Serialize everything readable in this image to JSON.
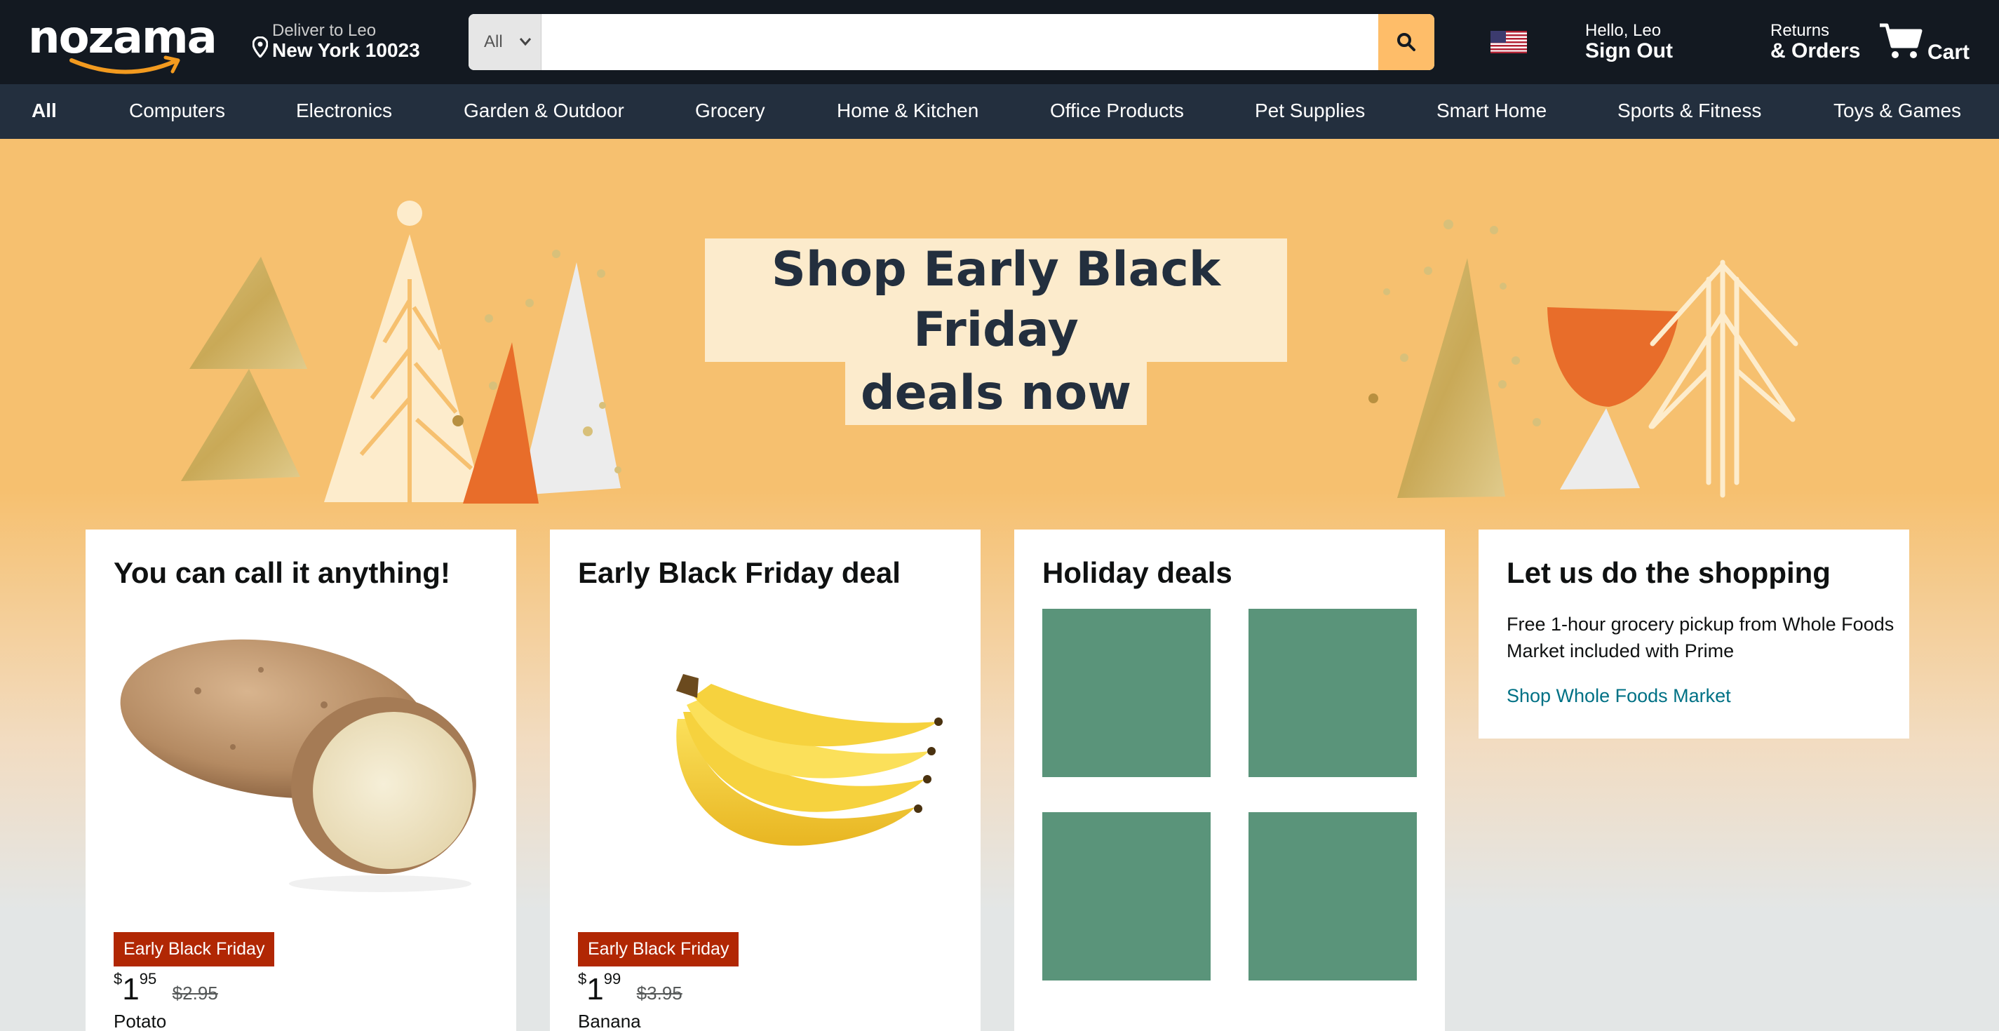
{
  "header": {
    "logo_text": "nozama",
    "deliver_line1": "Deliver to Leo",
    "deliver_line2": "New York 10023",
    "search": {
      "category": "All",
      "value": "",
      "placeholder": ""
    },
    "account_line1": "Hello, Leo",
    "account_line2": "Sign Out",
    "returns_line1": "Returns",
    "returns_line2": "& Orders",
    "cart_label": "Cart"
  },
  "nav": {
    "items": [
      {
        "label": "All"
      },
      {
        "label": "Computers"
      },
      {
        "label": "Electronics"
      },
      {
        "label": "Garden & Outdoor"
      },
      {
        "label": "Grocery"
      },
      {
        "label": "Home & Kitchen"
      },
      {
        "label": "Office Products"
      },
      {
        "label": "Pet Supplies"
      },
      {
        "label": "Smart Home"
      },
      {
        "label": "Sports & Fitness"
      },
      {
        "label": "Toys & Games"
      }
    ]
  },
  "hero": {
    "headline_line1": "Shop Early Black Friday",
    "headline_line2": "deals now"
  },
  "cards": [
    {
      "title": "You can call it anything!",
      "badge": "Early Black Friday",
      "price_currency": "$",
      "price_whole": "1",
      "price_fraction": "95",
      "old_price": "$2.95",
      "product_name": "Potato"
    },
    {
      "title": "Early Black Friday deal",
      "badge": "Early Black Friday",
      "price_currency": "$",
      "price_whole": "1",
      "price_fraction": "99",
      "old_price": "$3.95",
      "product_name": "Banana"
    },
    {
      "title": "Holiday deals"
    },
    {
      "title": "Let us do the shopping",
      "description": "Free 1-hour grocery pickup from Whole Foods Market included with Prime",
      "link": "Shop Whole Foods Market"
    }
  ],
  "colors": {
    "header_bg": "#131921",
    "nav_bg": "#232f3e",
    "search_button": "#febd69",
    "hero_orange": "#f6c06f",
    "badge_red": "#b12704",
    "tile_green": "#5a947a",
    "link_teal": "#007185"
  }
}
